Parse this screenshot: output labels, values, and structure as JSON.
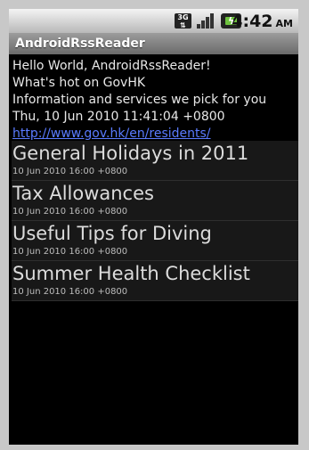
{
  "statusbar": {
    "network_label_top": "3G",
    "network_label_bottom": "⇅",
    "time": "4:42",
    "ampm": "AM"
  },
  "app": {
    "title": "AndroidRssReader"
  },
  "header": {
    "line1": "Hello World, AndroidRssReader!",
    "line2": "What's hot on GovHK",
    "line3": "Information and services we pick for you",
    "line4": "Thu, 10 Jun 2010 11:41:04 +0800",
    "link": "http://www.gov.hk/en/residents/"
  },
  "feed": {
    "items": [
      {
        "title": "General Holidays in 2011",
        "date": "10 Jun 2010 16:00 +0800"
      },
      {
        "title": "Tax Allowances",
        "date": "10 Jun 2010 16:00 +0800"
      },
      {
        "title": "Useful Tips for Diving",
        "date": "10 Jun 2010 16:00 +0800"
      },
      {
        "title": "Summer Health Checklist",
        "date": "10 Jun 2010 16:00 +0800"
      }
    ]
  }
}
